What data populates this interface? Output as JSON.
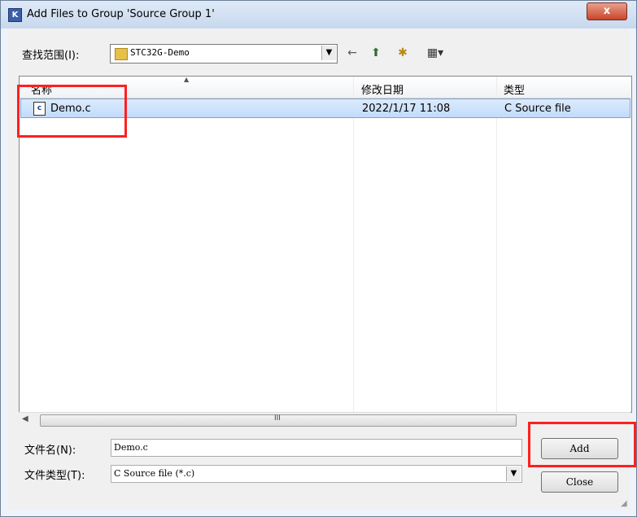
{
  "window": {
    "title": "Add Files to Group 'Source Group 1'",
    "close_symbol": "x"
  },
  "lookin": {
    "label": "查找范围(I):",
    "value": "STC32G-Demo"
  },
  "toolbar": {
    "back_symbol": "←",
    "up_symbol": "⬆",
    "newfolder_symbol": "✱",
    "view_symbol": "▦▾"
  },
  "filelist": {
    "headers": [
      "名称",
      "修改日期",
      "类型"
    ],
    "rows": [
      {
        "name": "Demo.c",
        "date": "2022/1/17 11:08",
        "type": "C Source file",
        "icon": "c"
      }
    ]
  },
  "scrollbar": {
    "grip": "III"
  },
  "filename": {
    "label": "文件名(N):",
    "value": "Demo.c"
  },
  "filetype": {
    "label": "文件类型(T):",
    "value": "C Source file (*.c)"
  },
  "buttons": {
    "add": "Add",
    "close": "Close"
  },
  "colors": {
    "highlight": "#ff2020",
    "selection": "#cce0fb"
  }
}
